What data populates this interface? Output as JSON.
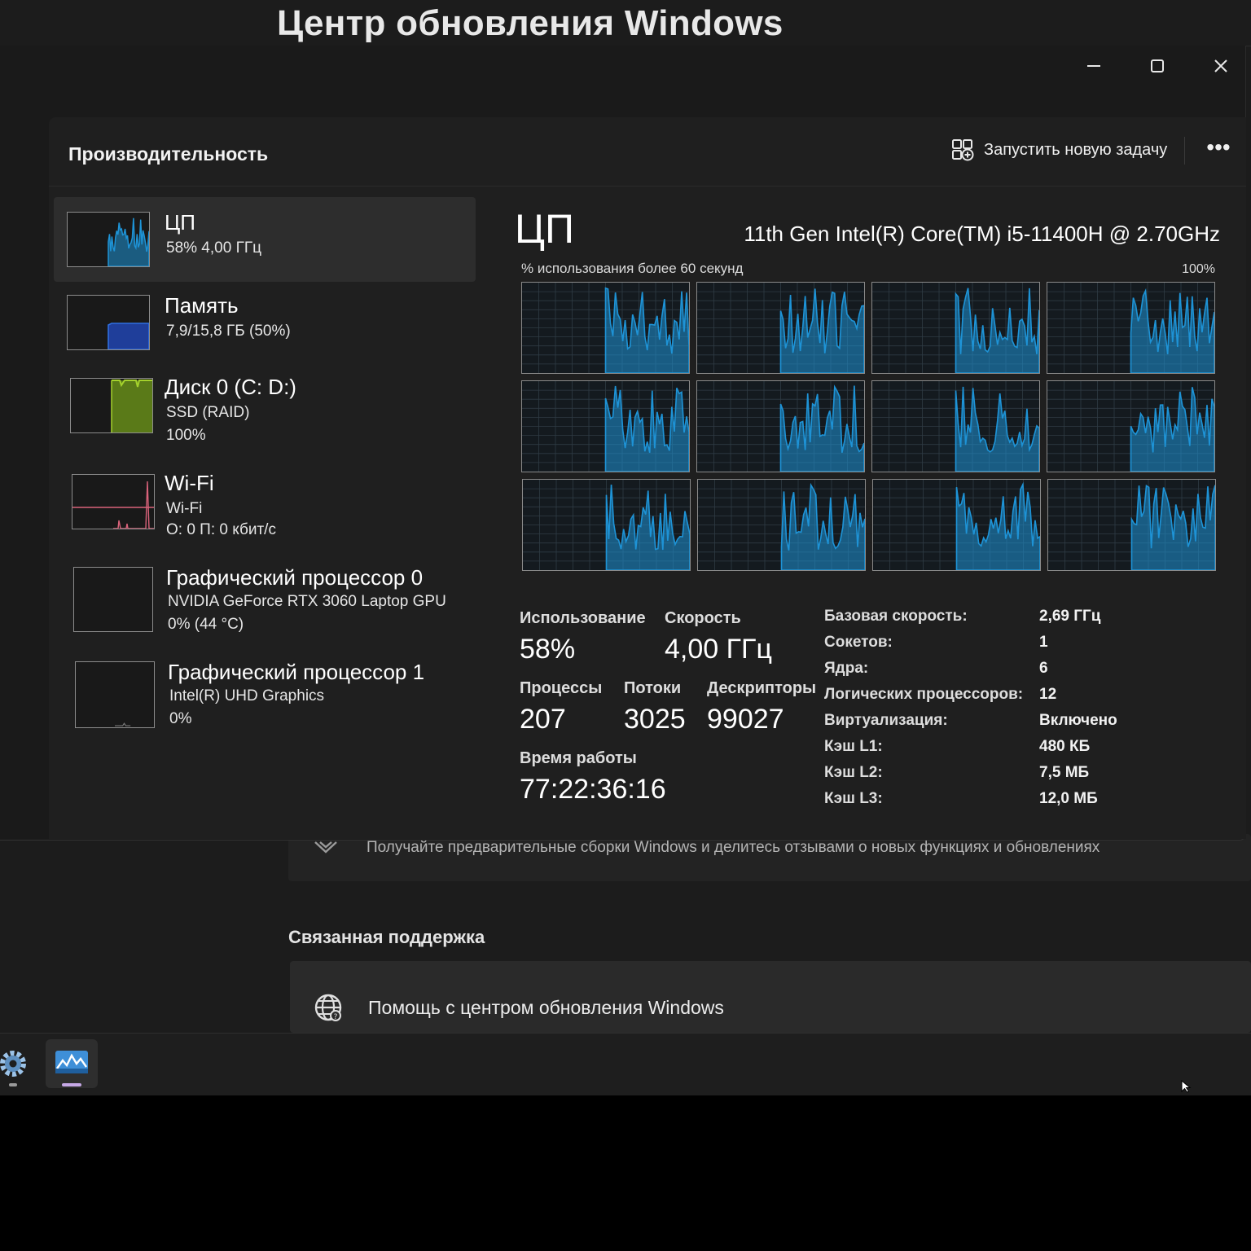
{
  "background_window": {
    "title": "Центр обновления Windows",
    "insider_text": "Получайте предварительные сборки Windows и делитесь отзывами о новых функциях и обновлениях",
    "related_support_title": "Связанная поддержка",
    "help_link": "Помощь с центром обновления Windows"
  },
  "taskbar": {
    "apps": [
      {
        "icon": "gear-icon",
        "name": "settings"
      },
      {
        "icon": "task-manager-icon",
        "name": "task-manager",
        "active": true
      }
    ]
  },
  "task_manager": {
    "page_title": "Производительность",
    "run_task_label": "Запустить новую задачу",
    "more_label": "•••",
    "window_controls": [
      "minimize-icon",
      "maximize-icon",
      "close-icon"
    ],
    "sidebar": {
      "items": [
        {
          "name": "ЦП",
          "line1": "58%  4,00 ГГц",
          "line2": "",
          "line3": "",
          "selected": true,
          "accent": "#1e93d6"
        },
        {
          "name": "Память",
          "line1": "7,9/15,8 ГБ (50%)",
          "line2": "",
          "line3": "",
          "accent": "#2f6fe0",
          "level": 0.5
        },
        {
          "name": "Диск 0 (C: D:)",
          "line1": "SSD (RAID)",
          "line2": "100%",
          "line3": "",
          "accent": "#8db72a",
          "level": 1.0
        },
        {
          "name": "Wi-Fi",
          "line1": "Wi-Fi",
          "line2": "О: 0 П: 0 кбит/с",
          "line3": "",
          "accent": "#d9627a"
        },
        {
          "name": "Графический процессор 0",
          "line1": "NVIDIA GeForce RTX 3060 Laptop GPU",
          "line2": "0%  (44 °C)",
          "line3": ""
        },
        {
          "name": "Графический процессор 1",
          "line1": "Intel(R) UHD Graphics",
          "line2": "0%",
          "line3": ""
        }
      ]
    },
    "cpu": {
      "title": "ЦП",
      "model": "11th Gen Intel(R) Core(TM) i5-11400H @ 2.70GHz",
      "graph_caption": "% использования более 60 секунд",
      "graph_max": "100%",
      "logical_processors_shown": 12,
      "graph_color": "#1e93d6",
      "stats": {
        "utilization_label": "Использование",
        "utilization_value": "58%",
        "speed_label": "Скорость",
        "speed_value": "4,00 ГГц",
        "processes_label": "Процессы",
        "processes_value": "207",
        "threads_label": "Потоки",
        "threads_value": "3025",
        "handles_label": "Дескрипторы",
        "handles_value": "99027",
        "uptime_label": "Время работы",
        "uptime_value": "77:22:36:16"
      },
      "info": [
        {
          "key": "Базовая скорость:",
          "value": "2,69 ГГц"
        },
        {
          "key": "Сокетов:",
          "value": "1"
        },
        {
          "key": "Ядра:",
          "value": "6"
        },
        {
          "key": "Логических процессоров:",
          "value": "12"
        },
        {
          "key": "Виртуализация:",
          "value": "Включено"
        },
        {
          "key": "Кэш L1:",
          "value": "480 КБ"
        },
        {
          "key": "Кэш L2:",
          "value": "7,5 МБ"
        },
        {
          "key": "Кэш L3:",
          "value": "12,0 МБ"
        }
      ]
    }
  }
}
